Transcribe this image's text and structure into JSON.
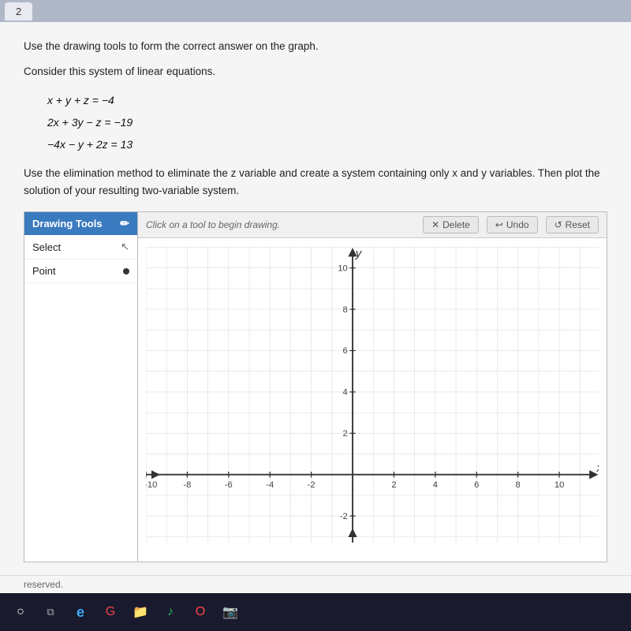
{
  "tab": {
    "label": "2"
  },
  "content": {
    "instruction1": "Use the drawing tools to form the correct answer on the graph.",
    "instruction2": "Consider this system of linear equations.",
    "equations": [
      "x + y + z = −4",
      "2x + 3y − z = −19",
      "−4x − y + 2z = 13"
    ],
    "instruction3": "Use the elimination method to eliminate the z variable and create a system containing only x and y variables. Then plot the solution of your resulting two-variable system."
  },
  "drawing_tools": {
    "header": "Drawing Tools",
    "pin_symbol": "📌",
    "tools": [
      {
        "label": "Select",
        "icon": "cursor"
      },
      {
        "label": "Point",
        "icon": "dot"
      }
    ]
  },
  "toolbar": {
    "instruction": "Click on a tool to begin drawing.",
    "delete_label": "Delete",
    "undo_label": "Undo",
    "reset_label": "Reset"
  },
  "graph": {
    "x_min": -10,
    "x_max": 10,
    "y_min": -4,
    "y_max": 10,
    "x_label": "x",
    "y_label": "y",
    "x_ticks": [
      -10,
      -8,
      -6,
      -4,
      -2,
      2,
      4,
      6,
      8,
      10
    ],
    "y_ticks": [
      -2,
      2,
      4,
      6,
      8,
      10
    ]
  },
  "reserved": {
    "text": "reserved."
  },
  "taskbar": {
    "icons": [
      "search",
      "task-view",
      "edge",
      "chrome",
      "file-explorer",
      "spotify",
      "opera",
      "camera"
    ]
  }
}
